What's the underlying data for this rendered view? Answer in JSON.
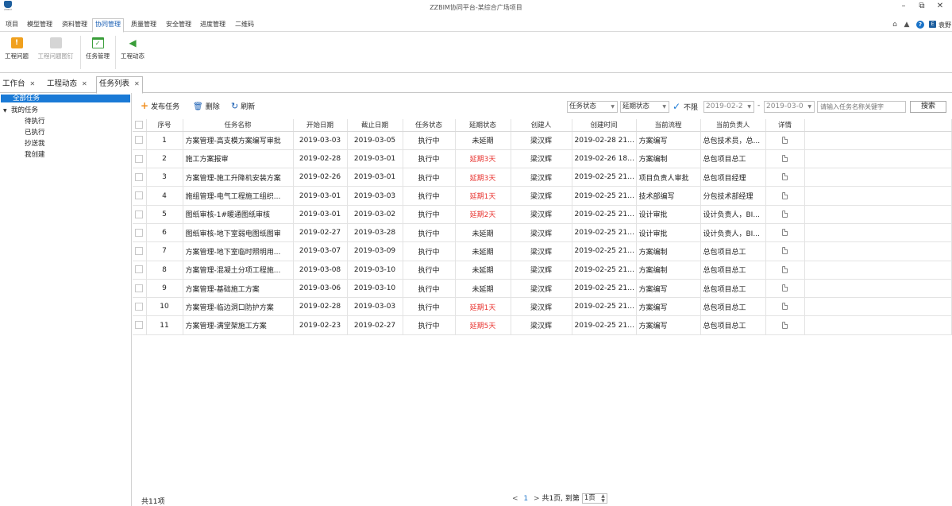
{
  "window": {
    "title": "ZZBIM协同平台-某综合广场项目",
    "logo_text": "ZZBIM"
  },
  "menu": {
    "items": [
      "项目",
      "模型管理",
      "资料管理",
      "协同管理",
      "质量管理",
      "安全管理",
      "进度管理",
      "二维码"
    ],
    "active": "协同管理"
  },
  "header_right": {
    "user_name": "袁野",
    "user_badge": "E",
    "help_glyph": "?"
  },
  "ribbon": {
    "buttons": [
      {
        "label": "工程问题",
        "icon": "warning-icon",
        "enabled": true
      },
      {
        "label": "工程问题图钉",
        "icon": "pin-icon",
        "enabled": false
      },
      {
        "label": "任务管理",
        "icon": "task-icon",
        "enabled": true
      },
      {
        "label": "工程动态",
        "icon": "speaker-icon",
        "enabled": true
      }
    ]
  },
  "tabs": [
    {
      "label": "工作台",
      "active": false
    },
    {
      "label": "工程动态",
      "active": false
    },
    {
      "label": "任务列表",
      "active": true
    }
  ],
  "tree": {
    "root": "全部任务",
    "group": "我的任务",
    "children": [
      "待执行",
      "已执行",
      "抄送我",
      "我创建"
    ]
  },
  "toolbar": {
    "publish": "发布任务",
    "delete": "删除",
    "refresh": "刷新",
    "status_select": "任务状态",
    "delay_select": "延期状态",
    "unlimited_label": "不限",
    "date_from": "2019-02-2",
    "date_to": "2019-03-0",
    "date_sep": "-",
    "search_placeholder": "请输入任务名称关键字",
    "search_button": "搜索"
  },
  "table": {
    "columns": [
      "序号",
      "任务名称",
      "开始日期",
      "截止日期",
      "任务状态",
      "延期状态",
      "创建人",
      "创建时间",
      "当前流程",
      "当前负责人",
      "详情"
    ],
    "rows": [
      {
        "no": "1",
        "name": "方案管理-高支模方案编写审批",
        "start": "2019-03-03",
        "end": "2019-03-05",
        "status": "执行中",
        "delay": "未延期",
        "creator": "梁汉辉",
        "created": "2019-02-28 21:...",
        "flow": "方案编写",
        "owner": "总包技术员，总..."
      },
      {
        "no": "2",
        "name": "施工方案报审",
        "start": "2019-02-28",
        "end": "2019-03-01",
        "status": "执行中",
        "delay": "延期3天",
        "creator": "梁汉辉",
        "created": "2019-02-26 18:...",
        "flow": "方案编制",
        "owner": "总包项目总工"
      },
      {
        "no": "3",
        "name": "方案管理-施工升降机安装方案",
        "start": "2019-02-26",
        "end": "2019-03-01",
        "status": "执行中",
        "delay": "延期3天",
        "creator": "梁汉辉",
        "created": "2019-02-25 21:...",
        "flow": "项目负责人审批",
        "owner": "总包项目经理"
      },
      {
        "no": "4",
        "name": "施组管理-电气工程施工组织...",
        "start": "2019-03-01",
        "end": "2019-03-03",
        "status": "执行中",
        "delay": "延期1天",
        "creator": "梁汉辉",
        "created": "2019-02-25 21:...",
        "flow": "技术部编写",
        "owner": "分包技术部经理"
      },
      {
        "no": "5",
        "name": "图纸审核-1#暖通图纸审核",
        "start": "2019-03-01",
        "end": "2019-03-02",
        "status": "执行中",
        "delay": "延期2天",
        "creator": "梁汉辉",
        "created": "2019-02-25 21:...",
        "flow": "设计审批",
        "owner": "设计负责人，BI..."
      },
      {
        "no": "6",
        "name": "图纸审核-地下室弱电图纸图审",
        "start": "2019-02-27",
        "end": "2019-03-28",
        "status": "执行中",
        "delay": "未延期",
        "creator": "梁汉辉",
        "created": "2019-02-25 21:...",
        "flow": "设计审批",
        "owner": "设计负责人，BI..."
      },
      {
        "no": "7",
        "name": "方案管理-地下室临时照明用...",
        "start": "2019-03-07",
        "end": "2019-03-09",
        "status": "执行中",
        "delay": "未延期",
        "creator": "梁汉辉",
        "created": "2019-02-25 21:...",
        "flow": "方案编制",
        "owner": "总包项目总工"
      },
      {
        "no": "8",
        "name": "方案管理-混凝土分项工程施...",
        "start": "2019-03-08",
        "end": "2019-03-10",
        "status": "执行中",
        "delay": "未延期",
        "creator": "梁汉辉",
        "created": "2019-02-25 21:...",
        "flow": "方案编制",
        "owner": "总包项目总工"
      },
      {
        "no": "9",
        "name": "方案管理-基础施工方案",
        "start": "2019-03-06",
        "end": "2019-03-10",
        "status": "执行中",
        "delay": "未延期",
        "creator": "梁汉辉",
        "created": "2019-02-25 21:...",
        "flow": "方案编写",
        "owner": "总包项目总工"
      },
      {
        "no": "10",
        "name": "方案管理-临边洞口防护方案",
        "start": "2019-02-28",
        "end": "2019-03-03",
        "status": "执行中",
        "delay": "延期1天",
        "creator": "梁汉辉",
        "created": "2019-02-25 21:...",
        "flow": "方案编写",
        "owner": "总包项目总工"
      },
      {
        "no": "11",
        "name": "方案管理-满堂架施工方案",
        "start": "2019-02-23",
        "end": "2019-02-27",
        "status": "执行中",
        "delay": "延期5天",
        "creator": "梁汉辉",
        "created": "2019-02-25 21:...",
        "flow": "方案编写",
        "owner": "总包项目总工"
      }
    ]
  },
  "footer": {
    "total": "共11项",
    "prev": "<",
    "current": "1",
    "next": ">",
    "pages": "共1页,",
    "goto": "到第",
    "page_select": "1页"
  },
  "colors": {
    "accent": "#1a7ad6",
    "delayed": "#e8322e",
    "warning": "#f0a01e",
    "green": "#3a9e3a"
  }
}
